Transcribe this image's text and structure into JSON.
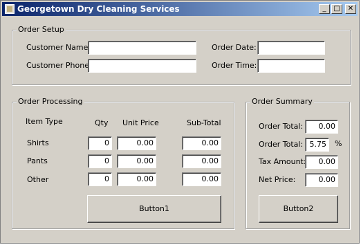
{
  "window": {
    "title": "Georgetown Dry Cleaning Services",
    "minimize_glyph": "_",
    "maximize_glyph": "□",
    "close_glyph": "✕"
  },
  "order_setup": {
    "legend": "Order Setup",
    "customer_name_label": "Customer Name:",
    "customer_name_value": "",
    "customer_phone_label": "Customer Phone:",
    "customer_phone_value": "",
    "order_date_label": "Order Date:",
    "order_date_value": "",
    "order_time_label": "Order Time:",
    "order_time_value": ""
  },
  "order_processing": {
    "legend": "Order Processing",
    "headers": {
      "item_type": "Item Type",
      "qty": "Qty",
      "unit_price": "Unit Price",
      "sub_total": "Sub-Total"
    },
    "rows": [
      {
        "item": "Shirts",
        "qty": "0",
        "unit_price": "0.00",
        "sub_total": "0.00"
      },
      {
        "item": "Pants",
        "qty": "0",
        "unit_price": "0.00",
        "sub_total": "0.00"
      },
      {
        "item": "Other",
        "qty": "0",
        "unit_price": "0.00",
        "sub_total": "0.00"
      }
    ],
    "button_label": "Button1"
  },
  "order_summary": {
    "legend": "Order Summary",
    "order_total_label": "Order Total:",
    "order_total_value": "0.00",
    "tax_rate_label": "Order Total:",
    "tax_rate_value": "5.75",
    "tax_rate_unit": "%",
    "tax_amount_label": "Tax Amount:",
    "tax_amount_value": "0.00",
    "net_price_label": "Net Price:",
    "net_price_value": "0.00",
    "button_label": "Button2"
  },
  "colors": {
    "window_bg": "#d4d0c8",
    "titlebar_start": "#0a246a",
    "titlebar_end": "#a6caf0",
    "title_text": "#ffffff"
  }
}
